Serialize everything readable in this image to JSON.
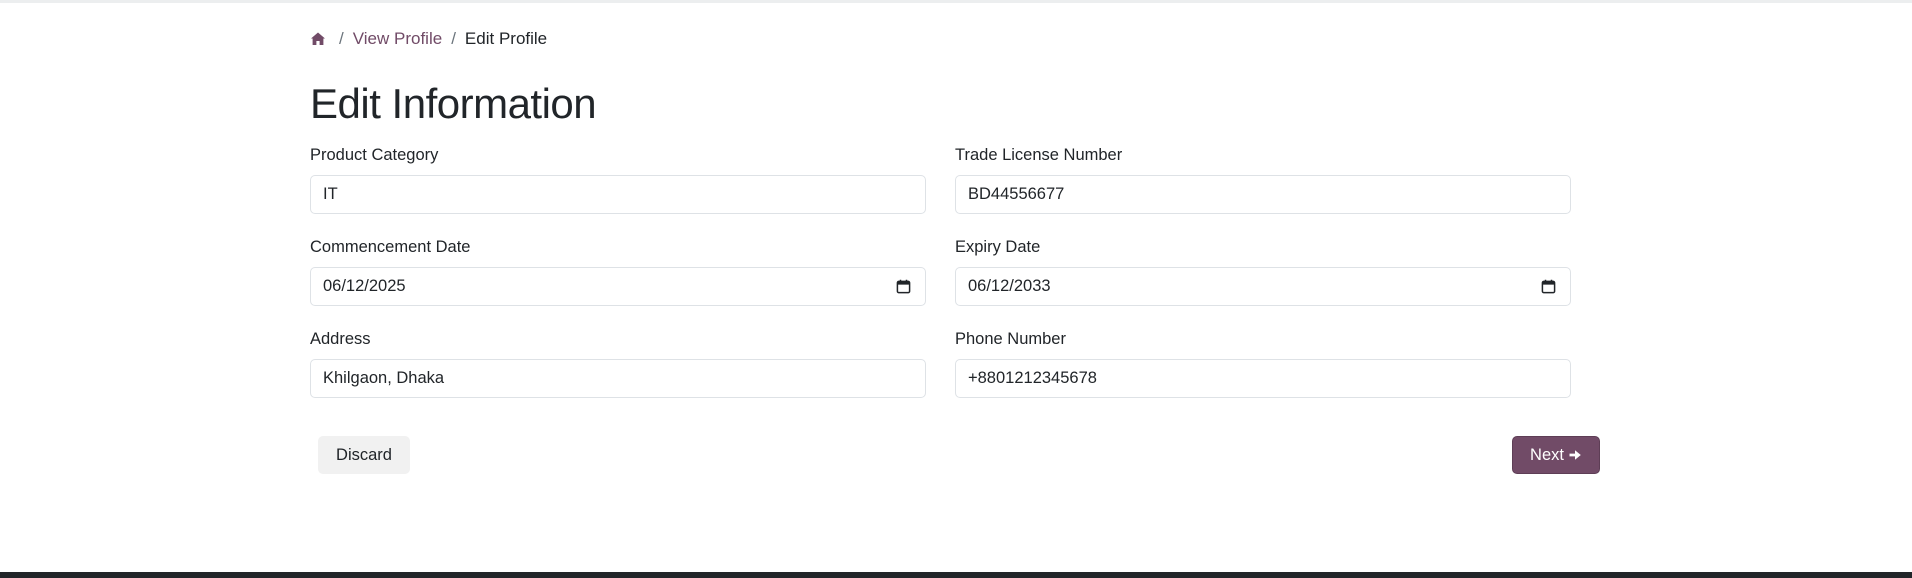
{
  "breadcrumb": {
    "home_icon": "home-icon",
    "separator": "/",
    "link_label": "View Profile",
    "current_label": "Edit Profile"
  },
  "page": {
    "title": "Edit Information"
  },
  "form": {
    "product_category": {
      "label": "Product Category",
      "value": "IT"
    },
    "trade_license": {
      "label": "Trade License Number",
      "value": "BD44556677"
    },
    "commencement_date": {
      "label": "Commencement Date",
      "value": "06/12/2025",
      "icon": "calendar-icon"
    },
    "expiry_date": {
      "label": "Expiry Date",
      "value": "06/12/2033",
      "icon": "calendar-icon"
    },
    "address": {
      "label": "Address",
      "value": "Khilgaon, Dhaka"
    },
    "phone_number": {
      "label": "Phone Number",
      "value": "+8801212345678"
    }
  },
  "actions": {
    "discard_label": "Discard",
    "next_label": "Next",
    "next_icon": "arrow-right-icon"
  },
  "colors": {
    "brand": "#714b67",
    "text": "#212529",
    "border": "#dee2e6",
    "discard_bg": "#f1f1f1",
    "footer": "#212529"
  }
}
